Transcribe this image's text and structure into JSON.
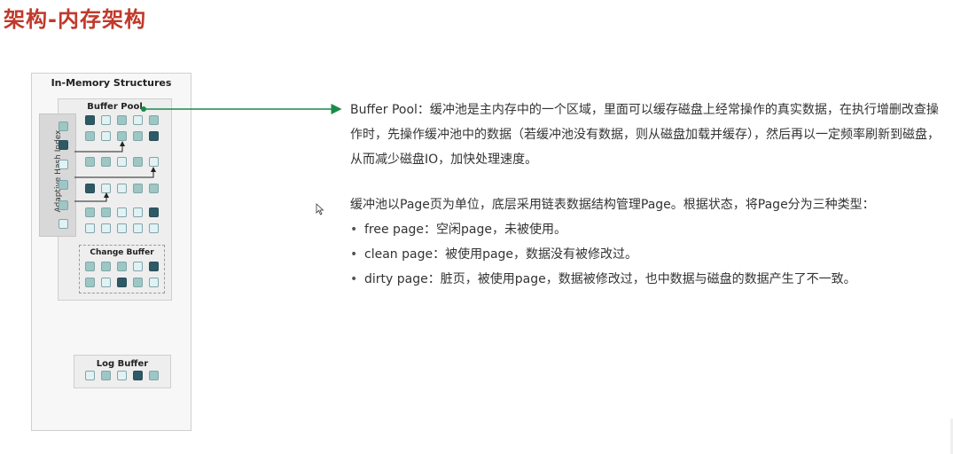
{
  "page_title": "架构-内存架构",
  "diagram": {
    "outer_title": "In-Memory Structures",
    "buffer_pool_title": "Buffer Pool",
    "adaptive_hash_index_label": "Adaptive Hash Index",
    "change_buffer_title": "Change Buffer",
    "log_buffer_title": "Log Buffer",
    "colors": {
      "free": "#e3f1f4",
      "clean": "#9ec6c4",
      "dirty": "#2d5a66",
      "arrow": "#1a8a4a"
    }
  },
  "description": {
    "paragraph1": "Buffer Pool：缓冲池是主内存中的一个区域，里面可以缓存磁盘上经常操作的真实数据，在执行增删改查操作时，先操作缓冲池中的数据（若缓冲池没有数据，则从磁盘加载并缓存），然后再以一定频率刷新到磁盘，从而减少磁盘IO，加快处理速度。",
    "paragraph2": "缓冲池以Page页为单位，底层采用链表数据结构管理Page。根据状态，将Page分为三种类型：",
    "bullets": [
      "free page：空闲page，未被使用。",
      "clean page：被使用page，数据没有被修改过。",
      "dirty page：脏页，被使用page，数据被修改过，也中数据与磁盘的数据产生了不一致。"
    ]
  }
}
